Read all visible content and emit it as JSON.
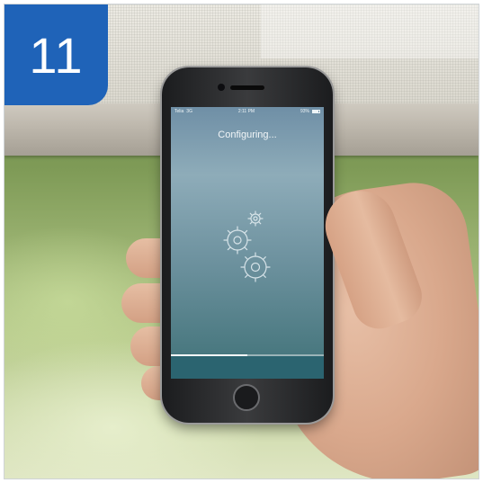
{
  "badge": {
    "step_number": "11",
    "color": "#1f63b8"
  },
  "phone": {
    "status_bar": {
      "carrier": "Telia",
      "network": "3G",
      "time": "2:11 PM",
      "battery": "93%"
    },
    "title": "Configuring...",
    "icon": "gears-icon",
    "progress": 0.5
  }
}
